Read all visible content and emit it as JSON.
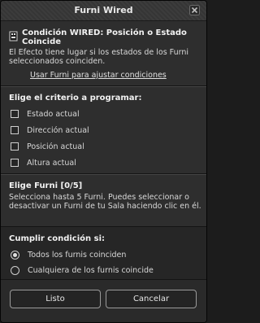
{
  "window": {
    "title": "Furni Wired"
  },
  "header": {
    "condition_title": "Condición WIRED: Posición o Estado Coincide",
    "description": "El Efecto tiene lugar si los estados de los Furni seleccionados coinciden.",
    "link": "Usar Furni para ajustar condiciones"
  },
  "criteria": {
    "heading": "Elige el criterio a programar:",
    "options": [
      {
        "label": "Estado actual",
        "checked": false
      },
      {
        "label": "Dirección actual",
        "checked": false
      },
      {
        "label": "Posición actual",
        "checked": false
      },
      {
        "label": "Altura actual",
        "checked": false
      }
    ]
  },
  "furni": {
    "heading": "Elige Furni [0/5]",
    "description": "Selecciona hasta 5 Furni. Puedes seleccionar o desactivar un Furni de tu Sala haciendo clic en él."
  },
  "condition": {
    "heading": "Cumplir condición si:",
    "options": [
      {
        "label": "Todos los furnis coinciden",
        "selected": true
      },
      {
        "label": "Cualquiera de los furnis coincide",
        "selected": false
      }
    ]
  },
  "buttons": {
    "ok": "Listo",
    "cancel": "Cancelar"
  }
}
